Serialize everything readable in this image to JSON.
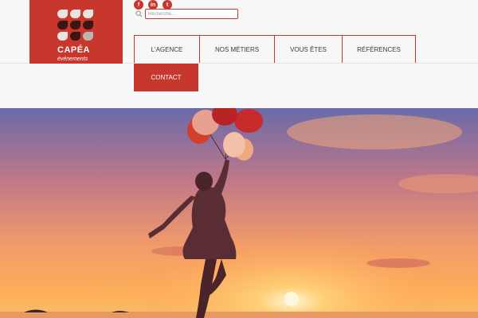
{
  "brand": {
    "name": "CAPÉA",
    "tagline": "événements"
  },
  "social": [
    {
      "label": "f",
      "icon": "facebook-icon"
    },
    {
      "label": "in",
      "icon": "linkedin-icon"
    },
    {
      "label": "t",
      "icon": "twitter-icon"
    }
  ],
  "search": {
    "placeholder": "Recherche...",
    "value": ""
  },
  "nav": {
    "agence": "L'AGENCE",
    "metiers": "NOS MÉTIERS",
    "vous_etes": "VOUS ÊTES",
    "references": "RÉFÉRENCES",
    "contact": "CONTACT"
  },
  "colors": {
    "brand_red": "#c8372d",
    "header_bg": "#f7f7f7"
  },
  "hero": {
    "image": "sunset beach with woman holding red balloons"
  }
}
